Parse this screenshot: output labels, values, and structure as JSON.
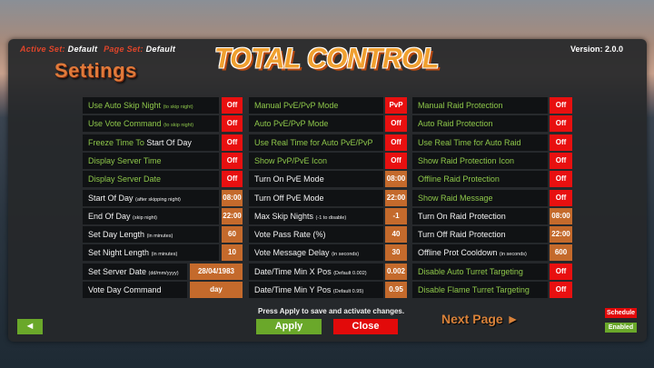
{
  "header": {
    "active_set_label": "Active Set:",
    "active_set_value": "Default",
    "page_set_label": "Page Set:",
    "page_set_value": "Default",
    "settings_title": "Settings",
    "logo_text": "TOTAL CONTROL",
    "version": "Version: 2.0.0"
  },
  "columns": [
    [
      {
        "label": "Use Auto Skip Night",
        "note": "(to skip night)",
        "value": "Off",
        "color": "green",
        "kind": "toggle"
      },
      {
        "label": "Use Vote Command",
        "note": "(to skip night)",
        "value": "Off",
        "color": "green",
        "kind": "toggle"
      },
      {
        "label": "Freeze Time To",
        "label_white": "Start Of Day",
        "value": "Off",
        "color": "green",
        "kind": "toggle"
      },
      {
        "label": "Display Server Time",
        "value": "Off",
        "color": "green",
        "kind": "toggle"
      },
      {
        "label": "Display Server Date",
        "value": "Off",
        "color": "green",
        "kind": "toggle"
      },
      {
        "label": "Start Of Day",
        "note": "(after skipping night)",
        "value": "08:00",
        "color": "white",
        "kind": "num"
      },
      {
        "label": "End Of Day",
        "note": "(skip night)",
        "value": "22:00",
        "color": "white",
        "kind": "num"
      },
      {
        "label": "Set Day Length",
        "note": "(in minutes)",
        "value": "60",
        "color": "white",
        "kind": "num"
      },
      {
        "label": "Set Night Length",
        "note": "(in minutes)",
        "value": "10",
        "color": "white",
        "kind": "num"
      },
      {
        "label": "Set Server Date",
        "note": "(dd/mm/yyyy)",
        "value": "28/04/1983",
        "color": "white",
        "kind": "wide"
      },
      {
        "label": "Vote Day Command",
        "value": "day",
        "color": "white",
        "kind": "wide"
      }
    ],
    [
      {
        "label": "Manual PvE/PvP Mode",
        "value": "PvP",
        "color": "green",
        "kind": "toggle"
      },
      {
        "label": "Auto PvE/PvP Mode",
        "value": "Off",
        "color": "green",
        "kind": "toggle"
      },
      {
        "label": "Use Real Time for Auto PvE/PvP",
        "value": "Off",
        "color": "green",
        "kind": "toggle"
      },
      {
        "label": "Show PvP/PvE Icon",
        "value": "Off",
        "color": "green",
        "kind": "toggle"
      },
      {
        "label": "Turn On PvE Mode",
        "value": "08:00",
        "color": "white",
        "kind": "num"
      },
      {
        "label": "Turn Off PvE Mode",
        "value": "22:00",
        "color": "white",
        "kind": "num"
      },
      {
        "label": "Max Skip Nights",
        "note": "(-1 to disable)",
        "value": "-1",
        "color": "white",
        "kind": "num"
      },
      {
        "label": "Vote Pass Rate (%)",
        "value": "40",
        "color": "white",
        "kind": "num"
      },
      {
        "label": "Vote Message Delay",
        "note": "(in seconds)",
        "value": "30",
        "color": "white",
        "kind": "num"
      },
      {
        "label": "Date/Time Min X Pos",
        "note": "(Default 0.002)",
        "value": "0.002",
        "color": "white",
        "kind": "num"
      },
      {
        "label": "Date/Time Min Y Pos",
        "note": "(Default 0.95)",
        "value": "0.95",
        "color": "white",
        "kind": "num"
      }
    ],
    [
      {
        "label": "Manual Raid Protection",
        "value": "Off",
        "color": "green",
        "kind": "toggle"
      },
      {
        "label": "Auto Raid Protection",
        "value": "Off",
        "color": "green",
        "kind": "toggle"
      },
      {
        "label": "Use Real Time for Auto Raid",
        "value": "Off",
        "color": "green",
        "kind": "toggle"
      },
      {
        "label": "Show Raid Protection Icon",
        "value": "Off",
        "color": "green",
        "kind": "toggle"
      },
      {
        "label": "Offline Raid Protection",
        "value": "Off",
        "color": "green",
        "kind": "toggle"
      },
      {
        "label": "Show Raid Message",
        "value": "Off",
        "color": "green",
        "kind": "toggle"
      },
      {
        "label": "Turn On Raid Protection",
        "value": "08:00",
        "color": "white",
        "kind": "num"
      },
      {
        "label": "Turn Off Raid Protection",
        "value": "22:00",
        "color": "white",
        "kind": "num"
      },
      {
        "label": "Offline Prot Cooldown",
        "note": "(in seconds)",
        "value": "600",
        "color": "white",
        "kind": "num"
      },
      {
        "label": "Disable Auto Turret Targeting",
        "value": "Off",
        "color": "green",
        "kind": "toggle"
      },
      {
        "label": "Disable Flame Turret Targeting",
        "value": "Off",
        "color": "green",
        "kind": "toggle"
      }
    ]
  ],
  "footer": {
    "note": "Press Apply to save and activate changes.",
    "apply_label": "Apply",
    "close_label": "Close",
    "next_page_label": "Next Page ►",
    "back_label": "◄",
    "schedule_label": "Schedule",
    "enabled_label": "Enabled"
  },
  "colors": {
    "green_text": "#8ec74a",
    "toggle_red": "#e81010",
    "number_orange": "#c46a2c",
    "apply_green": "#6aa82a"
  }
}
